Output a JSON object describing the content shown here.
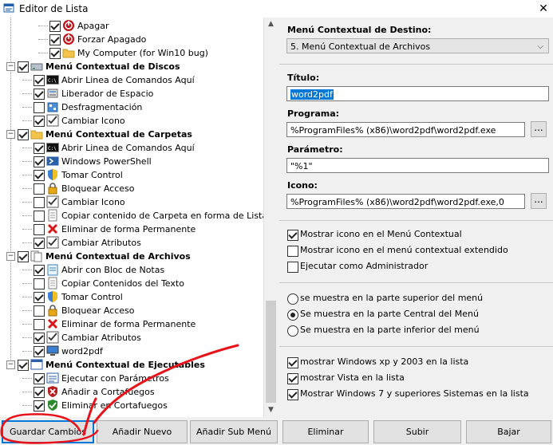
{
  "window": {
    "title": "Editor de Lista",
    "close": "✕"
  },
  "tree": {
    "rows": [
      {
        "label": "Apagar",
        "checked": true,
        "bold": false,
        "icon": "power-icon",
        "level": 3
      },
      {
        "label": "Forzar Apagado",
        "checked": true,
        "bold": false,
        "icon": "power-icon",
        "level": 3
      },
      {
        "label": "My Computer (for Win10 bug)",
        "checked": true,
        "bold": false,
        "icon": "folder-icon",
        "level": 3
      },
      {
        "label": "Menú Contextual de Discos",
        "checked": true,
        "bold": true,
        "icon": "drive-icon",
        "level": 1
      },
      {
        "label": "Abrir Linea de Comandos Aquí",
        "checked": true,
        "bold": false,
        "icon": "cmd-icon",
        "level": 2
      },
      {
        "label": "Liberador de Espacio",
        "checked": true,
        "bold": false,
        "icon": "cleanup-icon",
        "level": 2
      },
      {
        "label": "Desfragmentación",
        "checked": false,
        "bold": false,
        "icon": "defrag-icon",
        "level": 2
      },
      {
        "label": "Cambiar Icono",
        "checked": true,
        "bold": false,
        "icon": "checklist-icon",
        "level": 2
      },
      {
        "label": "Menú Contextual de Carpetas",
        "checked": true,
        "bold": true,
        "icon": "folder-icon",
        "level": 1
      },
      {
        "label": "Abrir Linea de Comandos Aquí",
        "checked": true,
        "bold": false,
        "icon": "cmd-icon",
        "level": 2
      },
      {
        "label": "Windows PowerShell",
        "checked": true,
        "bold": false,
        "icon": "powershell-icon",
        "level": 2
      },
      {
        "label": "Tomar Control",
        "checked": true,
        "bold": false,
        "icon": "shield-icon",
        "level": 2
      },
      {
        "label": "Bloquear Acceso",
        "checked": false,
        "bold": false,
        "icon": "lock-icon",
        "level": 2
      },
      {
        "label": "Cambiar Icono",
        "checked": false,
        "bold": false,
        "icon": "checklist-icon",
        "level": 2
      },
      {
        "label": "Copiar contenido de Carpeta en forma de Lista",
        "checked": false,
        "bold": false,
        "icon": "document-icon",
        "level": 2
      },
      {
        "label": "Eliminar de forma Permanente",
        "checked": false,
        "bold": false,
        "icon": "red-x-icon",
        "level": 2
      },
      {
        "label": "Cambiar Atributos",
        "checked": true,
        "bold": false,
        "icon": "checklist-icon",
        "level": 2
      },
      {
        "label": "Menú Contextual de Archivos",
        "checked": true,
        "bold": true,
        "icon": "files-icon",
        "level": 1
      },
      {
        "label": "Abrir con Bloc de Notas",
        "checked": true,
        "bold": false,
        "icon": "notepad-icon",
        "level": 2
      },
      {
        "label": "Copiar Contenidos del Texto",
        "checked": false,
        "bold": false,
        "icon": "document-icon",
        "level": 2
      },
      {
        "label": "Tomar Control",
        "checked": true,
        "bold": false,
        "icon": "shield-icon",
        "level": 2
      },
      {
        "label": "Bloquear Acceso",
        "checked": false,
        "bold": false,
        "icon": "lock-icon",
        "level": 2
      },
      {
        "label": "Eliminar de forma Permanente",
        "checked": false,
        "bold": false,
        "icon": "red-x-icon",
        "level": 2
      },
      {
        "label": "Cambiar Atributos",
        "checked": true,
        "bold": false,
        "icon": "checklist-icon",
        "level": 2
      },
      {
        "label": "word2pdf",
        "checked": true,
        "bold": false,
        "icon": "monitor-icon",
        "level": 2
      },
      {
        "label": "Menú Contextual de Ejecutables",
        "checked": true,
        "bold": true,
        "icon": "window-icon",
        "level": 1
      },
      {
        "label": "Ejecutar con Parámetros",
        "checked": true,
        "bold": false,
        "icon": "list-icon",
        "level": 2
      },
      {
        "label": "Añadir a Cortafuegos",
        "checked": true,
        "bold": false,
        "icon": "firewall-icon",
        "level": 2
      },
      {
        "label": "Eliminar en Cortafuegos",
        "checked": true,
        "bold": false,
        "icon": "firewall-ok-icon",
        "level": 2
      }
    ]
  },
  "panel": {
    "destino_label": "Menú Contextual de Destino:",
    "destino_value": "5. Menú Contextual de Archivos",
    "titulo_label": "Título:",
    "titulo_value": "word2pdf",
    "programa_label": "Programa:",
    "programa_value": "%ProgramFiles% (x86)\\word2pdf\\word2pdf.exe",
    "parametro_label": "Parámetro:",
    "parametro_value": "\"%1\"",
    "icono_label": "Icono:",
    "icono_value": "%ProgramFiles% (x86)\\word2pdf\\word2pdf.exe,0",
    "browse": "...",
    "checks": [
      {
        "label": "Mostrar icono en el Menú Contextual",
        "checked": true
      },
      {
        "label": "Mostrar icono en el menú contextual extendido",
        "checked": false
      },
      {
        "label": "Ejecutar como Administrador",
        "checked": false
      }
    ],
    "radios": [
      {
        "label": "se muestra en la parte superior del menú",
        "checked": false
      },
      {
        "label": "Se muestra en la parte Central del Menú",
        "checked": true
      },
      {
        "label": "Se muestra en la parte inferior del menú",
        "checked": false
      }
    ],
    "os_checks": [
      {
        "label": "mostrar Windows xp y 2003 en la lista",
        "checked": true
      },
      {
        "label": "mostrar Vista en la lista",
        "checked": true
      },
      {
        "label": "Mostrar Windows 7 y superiores Sistemas en la lista",
        "checked": true
      }
    ]
  },
  "buttons": {
    "guardar": "Guardar Cambios",
    "anadir": "Añadir Nuevo",
    "anadir_sub": "Añadir Sub Menú",
    "eliminar": "Eliminar",
    "subir": "Subir",
    "bajar": "Bajar"
  },
  "colors": {
    "accent": "#0078d7",
    "annotation": "#e8121b"
  }
}
